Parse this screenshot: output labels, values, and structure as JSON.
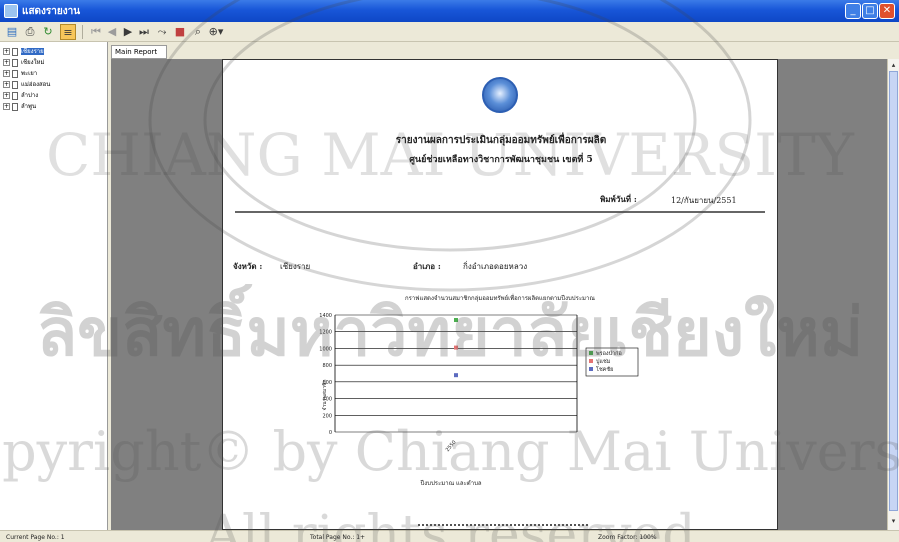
{
  "window": {
    "title": "แสดงรายงาน"
  },
  "toolbar": {
    "buttons": [
      {
        "icon": "export-icon"
      },
      {
        "icon": "print-icon"
      },
      {
        "icon": "refresh-icon"
      },
      {
        "icon": "group-tree-icon"
      },
      {
        "icon": "first-page-icon"
      },
      {
        "icon": "prev-page-icon"
      },
      {
        "icon": "next-page-icon"
      },
      {
        "icon": "last-page-icon"
      },
      {
        "icon": "goto-page-icon"
      },
      {
        "icon": "stop-icon"
      },
      {
        "icon": "search-icon"
      },
      {
        "icon": "zoom-icon"
      }
    ]
  },
  "tree": {
    "items": [
      {
        "label": "เชียงราย",
        "selected": true
      },
      {
        "label": "เชียงใหม่",
        "selected": false
      },
      {
        "label": "พะเยา",
        "selected": false
      },
      {
        "label": "แม่ฮ่องสอน",
        "selected": false
      },
      {
        "label": "ลำปาง",
        "selected": false
      },
      {
        "label": "ลำพูน",
        "selected": false
      }
    ]
  },
  "tab": {
    "label": "Main Report"
  },
  "report": {
    "title_line1": "รายงานผลการประเมินกลุ่มออมทรัพย์เพื่อการผลิต",
    "title_line2": "ศูนย์ช่วยเหลือทางวิชาการพัฒนาชุมชน เขตที่ 5",
    "print_date_label": "พิมพ์วันที่ :",
    "print_date_value": "12/กันยายน/2551",
    "province_label": "จังหวัด :",
    "province_value": "เชียงราย",
    "district_label": "อำเภอ :",
    "district_value": "กิ่งอำเภอดอยหลวง"
  },
  "chart_data": {
    "type": "scatter",
    "title": "กราฟแสดงจำนวนสมาชิกกลุ่มออมทรัพย์เพื่อการผลิตแยกตามปีงบประมาณ",
    "xlabel": "ปีงบประมาณ และตำบล",
    "ylabel": "จำนวนสมาชิก",
    "categories": [
      "2550"
    ],
    "ylim": [
      0,
      1400
    ],
    "yticks": [
      0,
      200,
      400,
      600,
      800,
      1000,
      1200,
      1400
    ],
    "grid": true,
    "legend_position": "right",
    "series": [
      {
        "name": "พรองป่าก่อ",
        "color": "#4caf50",
        "values": [
          1340
        ]
      },
      {
        "name": "ปูแช่ม",
        "color": "#e57373",
        "values": [
          1010
        ]
      },
      {
        "name": "โชคชัย",
        "color": "#5c6bc0",
        "values": [
          680
        ]
      }
    ]
  },
  "status": {
    "current_page": "Current Page No.: 1",
    "total_page": "Total Page No.: 1+",
    "zoom": "Zoom Factor: 100%"
  },
  "watermark": {
    "line1": "ลิขสิทธิ์มหาวิทยาลัยเชียงใหม่",
    "line2": "Copyright© by Chiang Mai University",
    "line3": "All rights reserved",
    "seal": "CHIANG MAI UNIVERSITY"
  }
}
